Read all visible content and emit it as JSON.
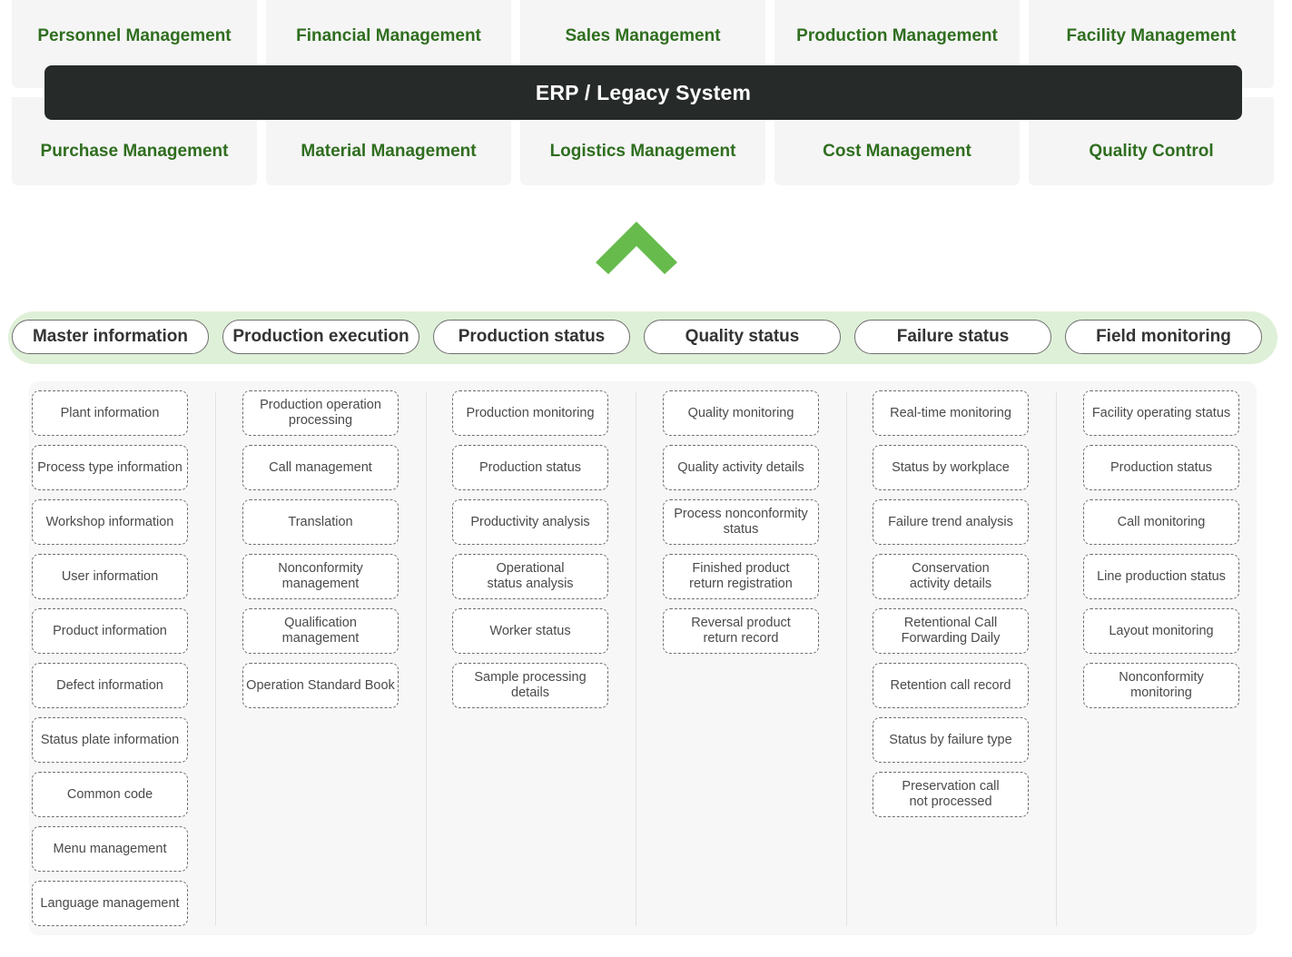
{
  "erp": {
    "title": "ERP / Legacy System",
    "top_modules": [
      "Personnel Management",
      "Financial Management",
      "Sales Management",
      "Production Management",
      "Facility Management"
    ],
    "bottom_modules": [
      "Purchase Management",
      "Material Management",
      "Logistics Management",
      "Cost Management",
      "Quality Control"
    ]
  },
  "colors": {
    "module_text": "#2f6e1f",
    "erp_bar": "#262a28",
    "arrow": "#66bb4c",
    "strip": "#dff0d8"
  },
  "arrow_icon": "chevron-up-icon",
  "categories": [
    {
      "label": "Master information",
      "items": [
        "Plant information",
        "Process type information",
        "Workshop information",
        "User information",
        "Product information",
        "Defect information",
        "Status plate information",
        "Common code",
        "Menu management",
        "Language management"
      ]
    },
    {
      "label": "Production execution",
      "items": [
        "Production operation\nprocessing",
        "Call management",
        "Translation",
        "Nonconformity\nmanagement",
        "Qualification\nmanagement",
        "Operation Standard Book"
      ]
    },
    {
      "label": "Production status",
      "items": [
        "Production monitoring",
        "Production status",
        "Productivity analysis",
        "Operational\nstatus analysis",
        "Worker status",
        "Sample processing\ndetails"
      ]
    },
    {
      "label": "Quality status",
      "items": [
        "Quality monitoring",
        "Quality activity details",
        "Process nonconformity\nstatus",
        "Finished product\nreturn registration",
        "Reversal product\nreturn record"
      ]
    },
    {
      "label": "Failure status",
      "items": [
        "Real-time monitoring",
        "Status by workplace",
        "Failure trend analysis",
        "Conservation\nactivity details",
        "Retentional Call\nForwarding Daily",
        "Retention call record",
        "Status by failure type",
        "Preservation call\nnot processed"
      ]
    },
    {
      "label": "Field monitoring",
      "items": [
        "Facility operating status",
        "Production status",
        "Call monitoring",
        "Line production status",
        "Layout monitoring",
        "Nonconformity\nmonitoring"
      ]
    }
  ]
}
